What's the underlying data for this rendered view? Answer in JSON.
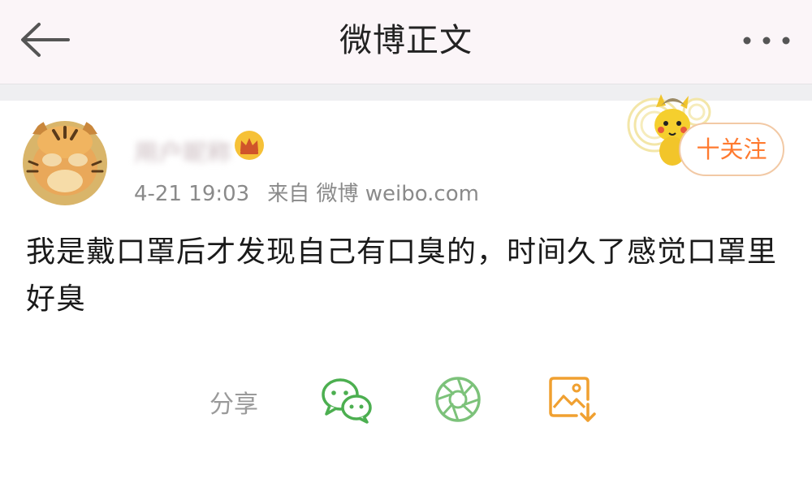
{
  "header": {
    "title": "微博正文",
    "back_icon": "arrow-left-icon",
    "more_icon": "more-dots-icon"
  },
  "post": {
    "author": {
      "name": "用户昵称",
      "avatar_icon": "tiger-avatar",
      "badge_icon": "crown-icon"
    },
    "time": "4-21 19:03",
    "source": "来自 微博 weibo.com",
    "follow_label": "十关注",
    "content": "我是戴口罩后才发现自己有口臭的，时间久了感觉口罩里好臭"
  },
  "share": {
    "label": "分享",
    "targets": [
      {
        "icon": "wechat-icon",
        "color": "#4caf50"
      },
      {
        "icon": "moments-icon",
        "color": "#7cc27a"
      },
      {
        "icon": "save-image-icon",
        "color": "#f0a030"
      }
    ]
  },
  "colors": {
    "accent": "#ff7a2f",
    "header_bg": "#fbf5f8",
    "follow_border": "#f2c9a5"
  }
}
